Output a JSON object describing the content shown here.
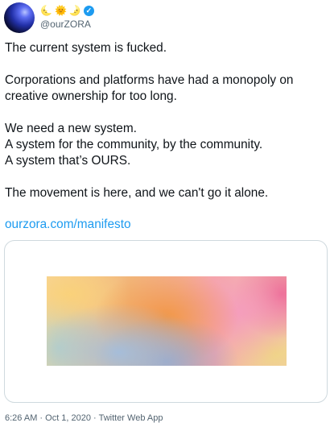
{
  "author": {
    "handle": "@ourZORA",
    "name_emojis": [
      "🌜",
      "🌞",
      "🌛"
    ],
    "verified_icon": "verified-badge-icon",
    "avatar_icon": "sphere-avatar-icon"
  },
  "tweet": {
    "paragraphs": [
      "The current system is fucked.",
      "Corporations and platforms have had a monopoly on creative ownership for too long.",
      "We need a new system.\nA system for the community, by the community.\nA system that’s OURS.",
      "The movement is here, and we can't go it alone."
    ],
    "link": "ourzora.com/manifesto",
    "meta": "6:26 AM · Oct 1, 2020 · Twitter Web App"
  },
  "colors": {
    "link": "#1d9bf0",
    "secondary_text": "#536471",
    "card_border": "#cfd9de"
  }
}
